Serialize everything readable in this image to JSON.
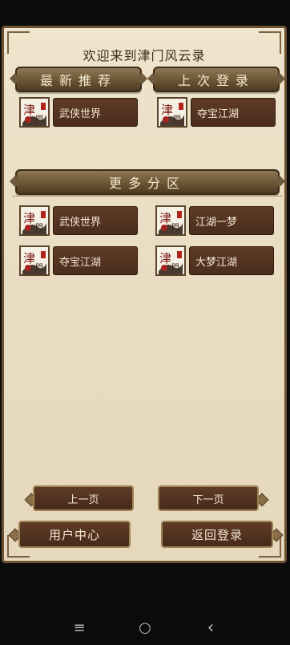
{
  "header": {
    "title": "欢迎来到津门风云录"
  },
  "sections": {
    "recommended": "最新推荐",
    "last_login": "上次登录",
    "more": "更多分区"
  },
  "recommended_servers": [
    {
      "name": "武侠世界"
    }
  ],
  "last_login_servers": [
    {
      "name": "夺宝江湖"
    }
  ],
  "more_servers": [
    {
      "name": "武侠世界"
    },
    {
      "name": "江湖一梦"
    },
    {
      "name": "夺宝江湖"
    },
    {
      "name": "大梦江湖"
    }
  ],
  "pagination": {
    "prev": "上一页",
    "next": "下一页"
  },
  "footer": {
    "user_center": "用户中心",
    "back_login": "返回登录"
  },
  "thumb": {
    "main": "津",
    "second": "門"
  },
  "system_nav": {
    "recents": "≡",
    "home": "○",
    "back": "‹"
  },
  "colors": {
    "panel": "#ebdfc5",
    "banner": "#6d5534",
    "button": "#4b2d1d",
    "text_light": "#f3e6cf"
  }
}
